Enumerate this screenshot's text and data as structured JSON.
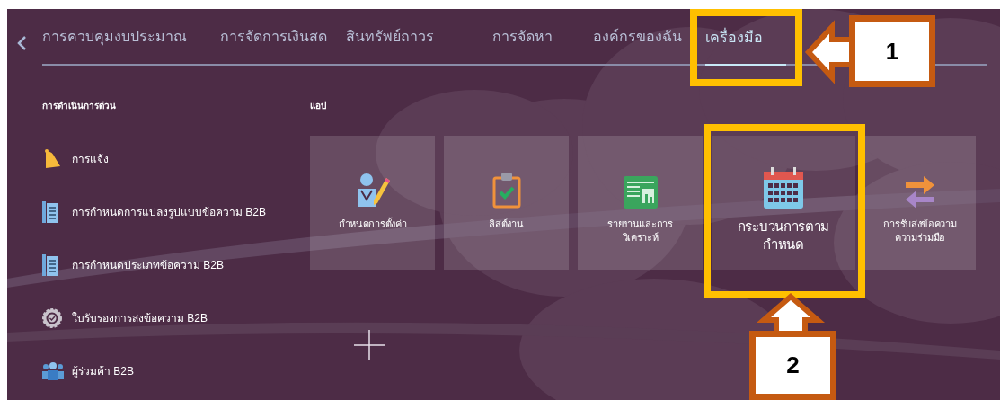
{
  "tabs": [
    {
      "label": "การควบคุมงบประมาณ",
      "selected": false
    },
    {
      "label": "การจัดการเงินสด",
      "selected": false
    },
    {
      "label": "สินทรัพย์ถาวร",
      "selected": false
    },
    {
      "label": "การจัดหา",
      "selected": false
    },
    {
      "label": "องค์กรของฉัน",
      "selected": false
    },
    {
      "label": "เครื่องมือ",
      "selected": true
    }
  ],
  "quick_actions": {
    "title": "การดำเนินการด่วน",
    "items": [
      {
        "label": "การแจ้ง",
        "kind": "bell"
      },
      {
        "label": "การกำหนดการแปลงรูปแบบข้อความ B2B",
        "kind": "document"
      },
      {
        "label": "การกำหนดประเภทข้อความ B2B",
        "kind": "document"
      },
      {
        "label": "ใบรับรองการส่งข้อความ B2B",
        "kind": "badge"
      },
      {
        "label": "ผู้ร่วมค้า B2B",
        "kind": "people"
      }
    ]
  },
  "apps": {
    "title": "แอป",
    "tiles": [
      {
        "label": "กำหนดการตั้งค่า",
        "kind": "setup",
        "highlighted": false
      },
      {
        "label": "ลิสต์งาน",
        "kind": "clipboard",
        "highlighted": false
      },
      {
        "label": "รายงานและการ\nวิเคราะห์",
        "kind": "report",
        "highlighted": false
      },
      {
        "label": "กระบวนการตาม\nกำหนด",
        "kind": "calendar",
        "highlighted": true
      },
      {
        "label": "การรับส่งข้อความ\nความร่วมมือ",
        "kind": "exchange",
        "highlighted": false
      }
    ]
  },
  "annotations": [
    {
      "label": "1"
    },
    {
      "label": "2"
    }
  ]
}
